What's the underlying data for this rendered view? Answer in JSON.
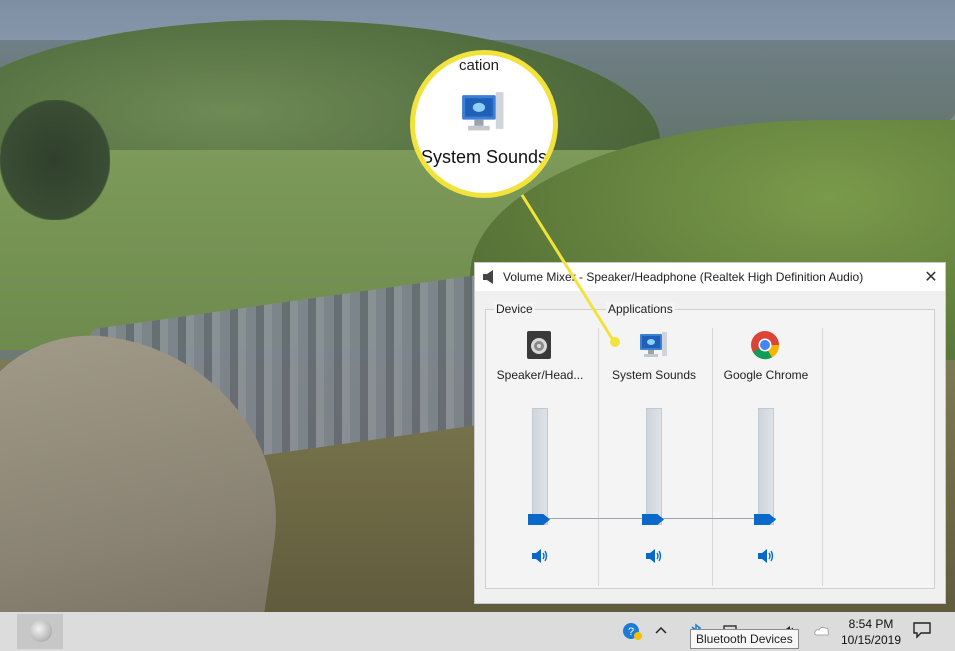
{
  "mixer": {
    "title": "Volume Mixer - Speaker/Headphone (Realtek High Definition Audio)",
    "close_glyph": "✕",
    "device_group_label": "Device",
    "applications_group_label": "Applications",
    "channels": [
      {
        "label": "Speaker/Head...",
        "icon": "speaker-icon",
        "level": 0
      },
      {
        "label": "System Sounds",
        "icon": "system-sounds-icon",
        "level": 0
      },
      {
        "label": "Google Chrome",
        "icon": "chrome-icon",
        "level": 0
      }
    ]
  },
  "callout": {
    "partial_text": "cation",
    "label": "System Sounds",
    "border_color": "#f1e33b"
  },
  "taskbar": {
    "tooltip": "Bluetooth Devices",
    "time": "8:54 PM",
    "date": "10/15/2019",
    "tray_icons": [
      "help-icon",
      "chevron-up-icon",
      "bluetooth-icon",
      "network-icon",
      "volume-icon",
      "onedrive-icon"
    ],
    "accent": "#0a68c8"
  }
}
